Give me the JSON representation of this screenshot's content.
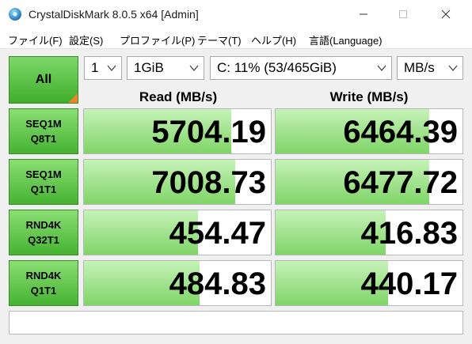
{
  "window": {
    "title": "CrystalDiskMark 8.0.5 x64 [Admin]",
    "icon": "crystaldiskmark-app-icon",
    "controls": [
      "minimize-icon",
      "maximize-icon",
      "close-icon"
    ]
  },
  "menu": [
    {
      "label": "ファイル(F)"
    },
    {
      "label": "設定(S)"
    },
    {
      "label": "プロファイル(P)"
    },
    {
      "label": "テーマ(T)"
    },
    {
      "label": "ヘルプ(H)"
    },
    {
      "label": "言語(Language)"
    }
  ],
  "toolbar": {
    "all_label": "All",
    "count": "1",
    "size": "1GiB",
    "drive": "C: 11% (53/465GiB)",
    "unit": "MB/s"
  },
  "columns": {
    "read": "Read (MB/s)",
    "write": "Write (MB/s)"
  },
  "rows": [
    {
      "line1": "SEQ1M",
      "line2": "Q8T1",
      "read": "5704.19",
      "write": "6464.39",
      "read_fill_pct": 79,
      "write_fill_pct": 82
    },
    {
      "line1": "SEQ1M",
      "line2": "Q1T1",
      "read": "7008.73",
      "write": "6477.72",
      "read_fill_pct": 81,
      "write_fill_pct": 82
    },
    {
      "line1": "RND4K",
      "line2": "Q32T1",
      "read": "454.47",
      "write": "416.83",
      "read_fill_pct": 61,
      "write_fill_pct": 59
    },
    {
      "line1": "RND4K",
      "line2": "Q1T1",
      "read": "484.83",
      "write": "440.17",
      "read_fill_pct": 62,
      "write_fill_pct": 60
    }
  ],
  "status": "",
  "colors": {
    "accent_green": "#46b331",
    "bar_green": "#7fd567",
    "corner_orange": "#e8872a"
  }
}
